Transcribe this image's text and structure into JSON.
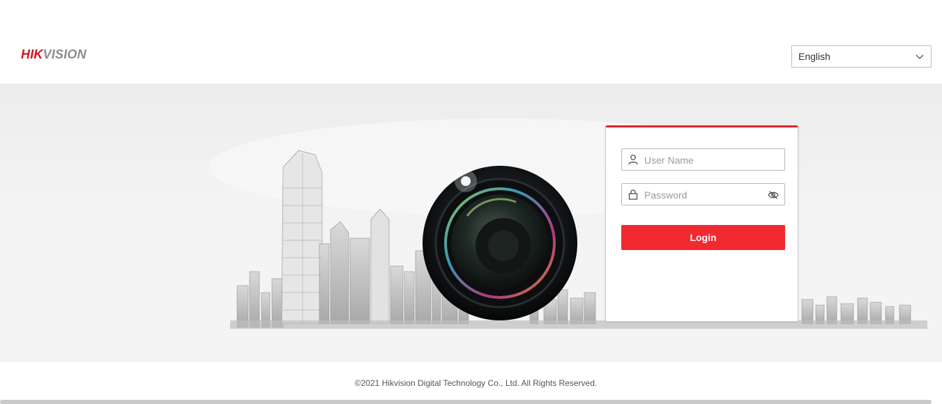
{
  "brand": {
    "part1": "HIK",
    "part2": "VISION"
  },
  "language": {
    "selected": "English"
  },
  "login": {
    "username_placeholder": "User Name",
    "password_placeholder": "Password",
    "button_label": "Login"
  },
  "footer": {
    "copyright": "©2021 Hikvision Digital Technology Co., Ltd. All Rights Reserved."
  },
  "colors": {
    "accent": "#f02a30",
    "brand_red": "#d3121c",
    "brand_gray": "#8c8c8c"
  },
  "icons": [
    "chevron-down-icon",
    "user-icon",
    "lock-icon",
    "eye-off-icon",
    "camera-lens-illustration"
  ]
}
